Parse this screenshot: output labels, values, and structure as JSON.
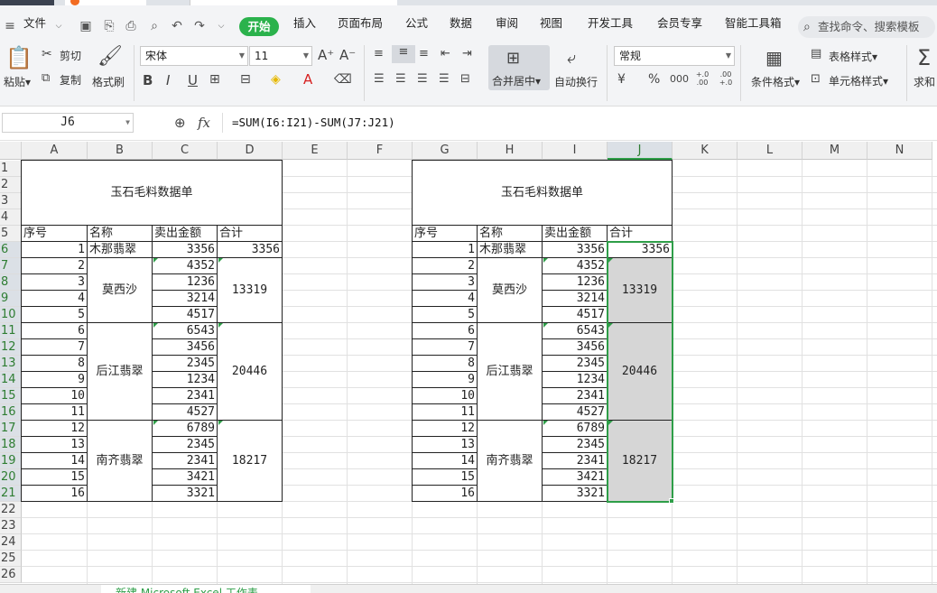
{
  "menu": {
    "file_label": "文件",
    "start_label": "开始",
    "items": [
      "插入",
      "页面布局",
      "公式",
      "数据",
      "审阅",
      "视图",
      "开发工具",
      "会员专享",
      "智能工具箱"
    ],
    "search_placeholder": "查找命令、搜索模板"
  },
  "ribbon": {
    "paste": "粘贴",
    "cut": "剪切",
    "copy": "复制",
    "format_painter": "格式刷",
    "font_name": "宋体",
    "font_size": "11",
    "merge_center": "合并居中",
    "wrap_text": "自动换行",
    "number_format": "常规",
    "table_style": "表格样式",
    "cell_style": "单元格样式",
    "conditional_format": "条件格式",
    "sum": "求和",
    "percent_symbol": "%",
    "currency_symbol": "¥",
    "thousands": "000",
    "inc_decimal": "+.0 .00",
    "dec_decimal": ".00 +.0"
  },
  "formula_bar": {
    "cell_ref": "J6",
    "fx_label": "fx",
    "formula": "=SUM(I6:I21)-SUM(J7:J21)"
  },
  "sheet": {
    "columns": [
      "A",
      "B",
      "C",
      "D",
      "E",
      "F",
      "G",
      "H",
      "I",
      "J",
      "K",
      "L",
      "M",
      "N"
    ],
    "rows": [
      "1",
      "2",
      "3",
      "4",
      "5",
      "6",
      "7",
      "8",
      "9",
      "10",
      "11",
      "12",
      "13",
      "14",
      "15",
      "16",
      "17",
      "18",
      "19",
      "20",
      "21",
      "22",
      "23",
      "24",
      "25",
      "26"
    ],
    "selected_column": "J",
    "selected_rows_from": 6,
    "selected_rows_to": 21
  },
  "table_left": {
    "title": "玉石毛料数据单",
    "headers": [
      "序号",
      "名称",
      "卖出金额",
      "合计"
    ],
    "seq": [
      "1",
      "2",
      "3",
      "4",
      "5",
      "6",
      "7",
      "8",
      "9",
      "10",
      "11",
      "12",
      "13",
      "14",
      "15",
      "16"
    ],
    "names": [
      {
        "label": "木那翡翠",
        "rows": 1
      },
      {
        "label": "莫西沙",
        "rows": 4
      },
      {
        "label": "后江翡翠",
        "rows": 6
      },
      {
        "label": "南齐翡翠",
        "rows": 5
      }
    ],
    "amounts": [
      "3356",
      "4352",
      "1236",
      "3214",
      "4517",
      "6543",
      "3456",
      "2345",
      "1234",
      "2341",
      "4527",
      "6789",
      "2345",
      "2341",
      "3421",
      "3321"
    ],
    "totals": [
      "3356",
      "13319",
      "20446",
      "18217"
    ]
  },
  "table_right": {
    "title": "玉石毛料数据单",
    "headers": [
      "序号",
      "名称",
      "卖出金额",
      "合计"
    ],
    "seq": [
      "1",
      "2",
      "3",
      "4",
      "5",
      "6",
      "7",
      "8",
      "9",
      "10",
      "11",
      "12",
      "13",
      "14",
      "15",
      "16"
    ],
    "names": [
      {
        "label": "木那翡翠",
        "rows": 1
      },
      {
        "label": "莫西沙",
        "rows": 4
      },
      {
        "label": "后江翡翠",
        "rows": 6
      },
      {
        "label": "南齐翡翠",
        "rows": 5
      }
    ],
    "amounts": [
      "3356",
      "4352",
      "1236",
      "3214",
      "4517",
      "6543",
      "3456",
      "2345",
      "1234",
      "2341",
      "4527",
      "6789",
      "2345",
      "2341",
      "3421",
      "3321"
    ],
    "totals": [
      "3356",
      "13319",
      "20446",
      "18217"
    ]
  },
  "sheet_tab": {
    "label": "新建 Microsoft Excel 工作表"
  },
  "colors": {
    "accent_green": "#2bb24c",
    "selection_green": "#2e9e48",
    "selected_fill": "#d6d6d6"
  }
}
